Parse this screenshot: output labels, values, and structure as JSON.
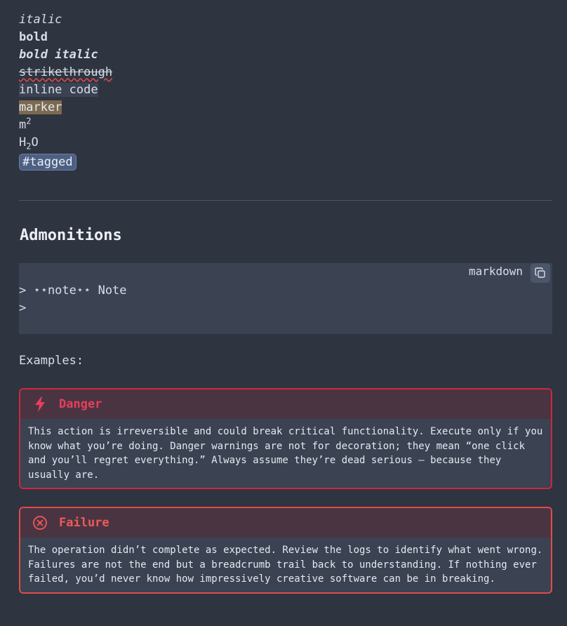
{
  "formatting": {
    "italic": "italic",
    "bold": "bold",
    "bold_italic": "bold italic",
    "strikethrough": "strikethrough",
    "inline_code": "inline code",
    "marker": "marker",
    "sup_base": "m",
    "sup_exp": "2",
    "sub_pre": "H",
    "sub_idx": "2",
    "sub_post": "O",
    "tag": "#tagged"
  },
  "section": {
    "heading": "Admonitions"
  },
  "code_block": {
    "language": "markdown",
    "copy_icon": "copy-icon",
    "lines": [
      "> ⋆⋆note⋆⋆ Note",
      ">"
    ]
  },
  "examples_label": "Examples:",
  "admonitions": [
    {
      "type": "danger",
      "icon": "lightning-icon",
      "title": "Danger",
      "text": "This action is irreversible and could break critical functionality. Execute only if you know what you’re doing. Danger warnings are not for decoration; they mean “one click and you’ll regret everything.” Always assume they’re dead serious — because they usually are."
    },
    {
      "type": "failure",
      "icon": "x-circle-icon",
      "title": "Failure",
      "text": "The operation didn’t complete as expected. Review the logs to identify what went wrong. Failures are not the end but a breadcrumb trail back to understanding. If nothing ever failed, you’d never know how impressively creative software can be in breaking."
    }
  ],
  "colors": {
    "background": "#2e3440",
    "danger": "#e83e5c",
    "failure": "#ef5a5a",
    "marker": "#7b6a4f",
    "tag": "#4c6083"
  }
}
